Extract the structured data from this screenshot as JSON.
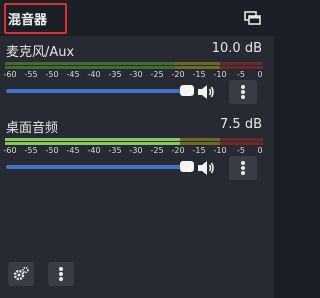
{
  "dock": {
    "title": "混音器",
    "undock_icon": "undock-window-icon"
  },
  "channels": [
    {
      "name": "麦克风/Aux",
      "db": "10.0 dB",
      "level_fraction": 0.0,
      "volume_fraction": 1.0,
      "icons": {
        "volume": "speaker-icon",
        "menu": "more-vertical-icon"
      }
    },
    {
      "name": "桌面音频",
      "db": "7.5 dB",
      "level_fraction": 0.68,
      "volume_fraction": 1.0,
      "icons": {
        "volume": "speaker-icon",
        "menu": "more-vertical-icon"
      }
    }
  ],
  "scale": [
    "-60",
    "-55",
    "-50",
    "-45",
    "-40",
    "-35",
    "-30",
    "-25",
    "-20",
    "-15",
    "-10",
    "-5",
    "0"
  ],
  "bottom_toolbar": {
    "settings_icon": "gears-icon",
    "menu_icon": "more-vertical-icon"
  },
  "colors": {
    "accent": "#3d74c6",
    "title_outline": "#d9322b",
    "meter_green": "#89c95b"
  }
}
